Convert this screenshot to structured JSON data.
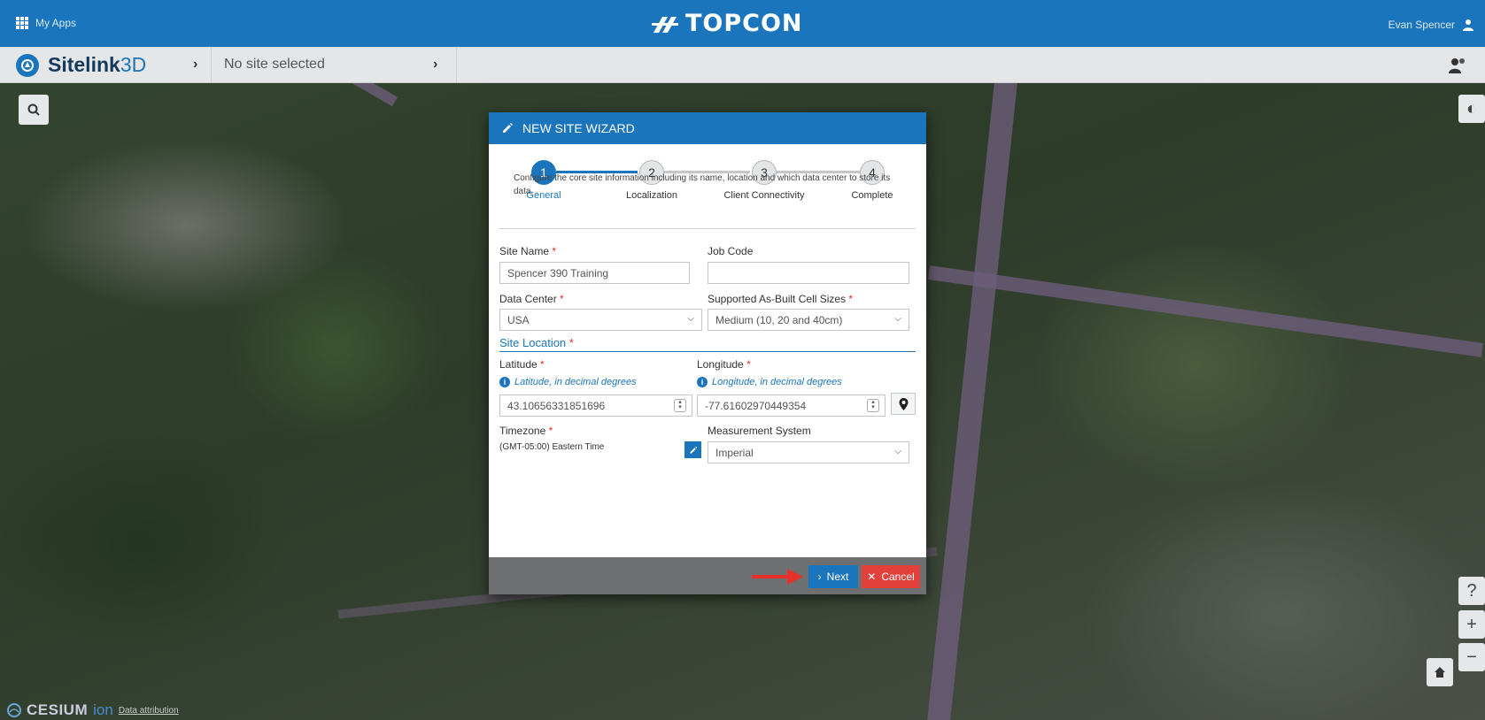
{
  "topbar": {
    "apps_label": "My Apps",
    "brand": "TOPCON",
    "user_name": "Evan Spencer"
  },
  "sitebar": {
    "app_name_bold": "Sitelink",
    "app_name_thin": "3D",
    "site_selector": "No site selected"
  },
  "map": {
    "attribution_brand": "CESIUM",
    "attribution_ion": "ion",
    "attribution_link": "Data attribution"
  },
  "wizard": {
    "title": "NEW SITE WIZARD",
    "steps": [
      {
        "number": "1",
        "label": "General",
        "active": true
      },
      {
        "number": "2",
        "label": "Localization",
        "active": false
      },
      {
        "number": "3",
        "label": "Client Connectivity",
        "active": false
      },
      {
        "number": "4",
        "label": "Complete",
        "active": false
      }
    ],
    "description": "Configure the core site information including its name, location and which data center to store its data.",
    "site_name": {
      "label": "Site Name",
      "required": "*",
      "value": "Spencer 390 Training"
    },
    "job_code": {
      "label": "Job Code",
      "value": ""
    },
    "data_center": {
      "label": "Data Center",
      "required": "*",
      "value": "USA"
    },
    "cell_sizes": {
      "label": "Supported As-Built Cell Sizes",
      "required": "*",
      "value": "Medium (10, 20 and 40cm)"
    },
    "site_location": {
      "label": "Site Location",
      "required": "*"
    },
    "latitude": {
      "label": "Latitude",
      "required": "*",
      "hint": "Latitude, in decimal degrees",
      "value": "43.10656331851696"
    },
    "longitude": {
      "label": "Longitude",
      "required": "*",
      "hint": "Longitude, in decimal degrees",
      "value": "-77.61602970449354"
    },
    "timezone": {
      "label": "Timezone",
      "required": "*",
      "value": "(GMT-05:00) Eastern Time"
    },
    "measurement": {
      "label": "Measurement System",
      "value": "Imperial"
    },
    "next_label": "Next",
    "cancel_label": "Cancel"
  },
  "colors": {
    "brand_blue": "#1b75bc",
    "cancel_red": "#e2403a",
    "annotation_arrow": "#e8302a"
  }
}
